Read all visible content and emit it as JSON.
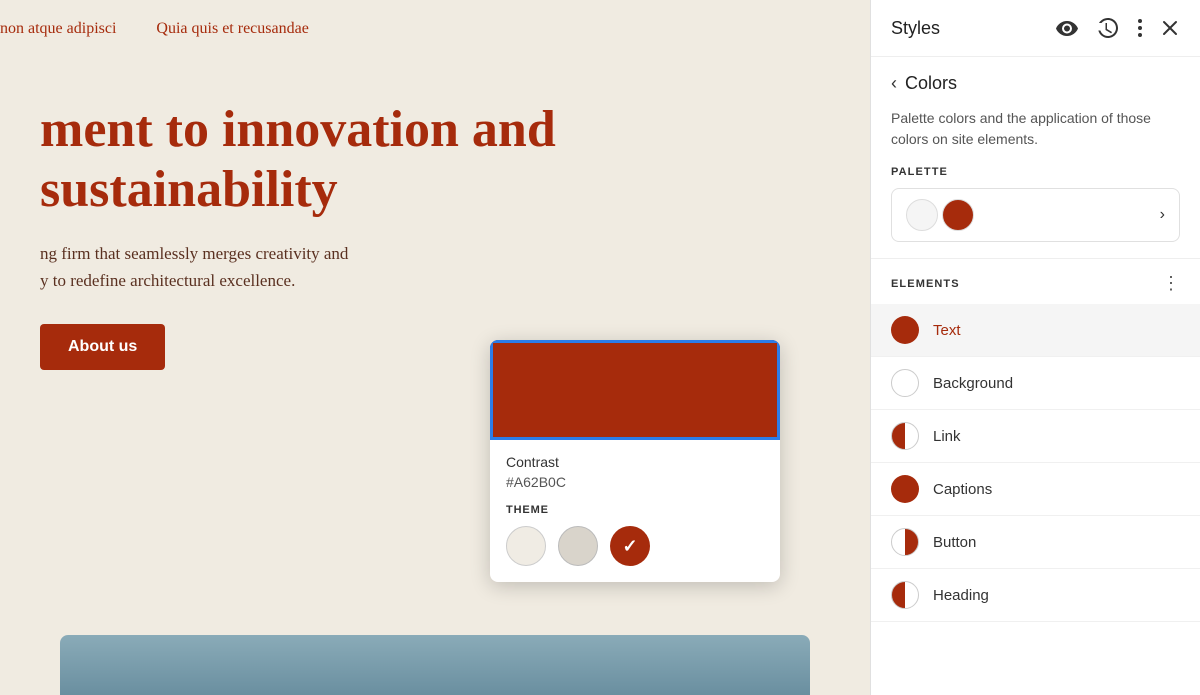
{
  "preview": {
    "nav_items": [
      "non atque adipisci",
      "Quia quis et recusandae"
    ],
    "heading_line1": "ment to innovation and",
    "heading_line2": "sustainability",
    "subtext_line1": "ng firm that seamlessly merges creativity and",
    "subtext_line2": "y to redefine architectural excellence.",
    "about_button": "About us"
  },
  "color_picker": {
    "swatch_color": "#A62B0C",
    "contrast_label": "Contrast",
    "hex_value": "#A62B0C",
    "theme_label": "THEME"
  },
  "styles_panel": {
    "title": "Styles",
    "colors_section_title": "Colors",
    "description": "Palette colors and the application of those colors on site elements.",
    "palette_label": "PALETTE",
    "elements_label": "ELEMENTS",
    "elements": [
      {
        "label": "Text",
        "icon_type": "full-red",
        "active": true
      },
      {
        "label": "Background",
        "icon_type": "empty",
        "active": false
      },
      {
        "label": "Link",
        "icon_type": "half",
        "active": false
      },
      {
        "label": "Captions",
        "icon_type": "full-red",
        "active": false
      },
      {
        "label": "Button",
        "icon_type": "half-red",
        "active": false
      },
      {
        "label": "Heading",
        "icon_type": "half-red",
        "active": false
      }
    ]
  }
}
